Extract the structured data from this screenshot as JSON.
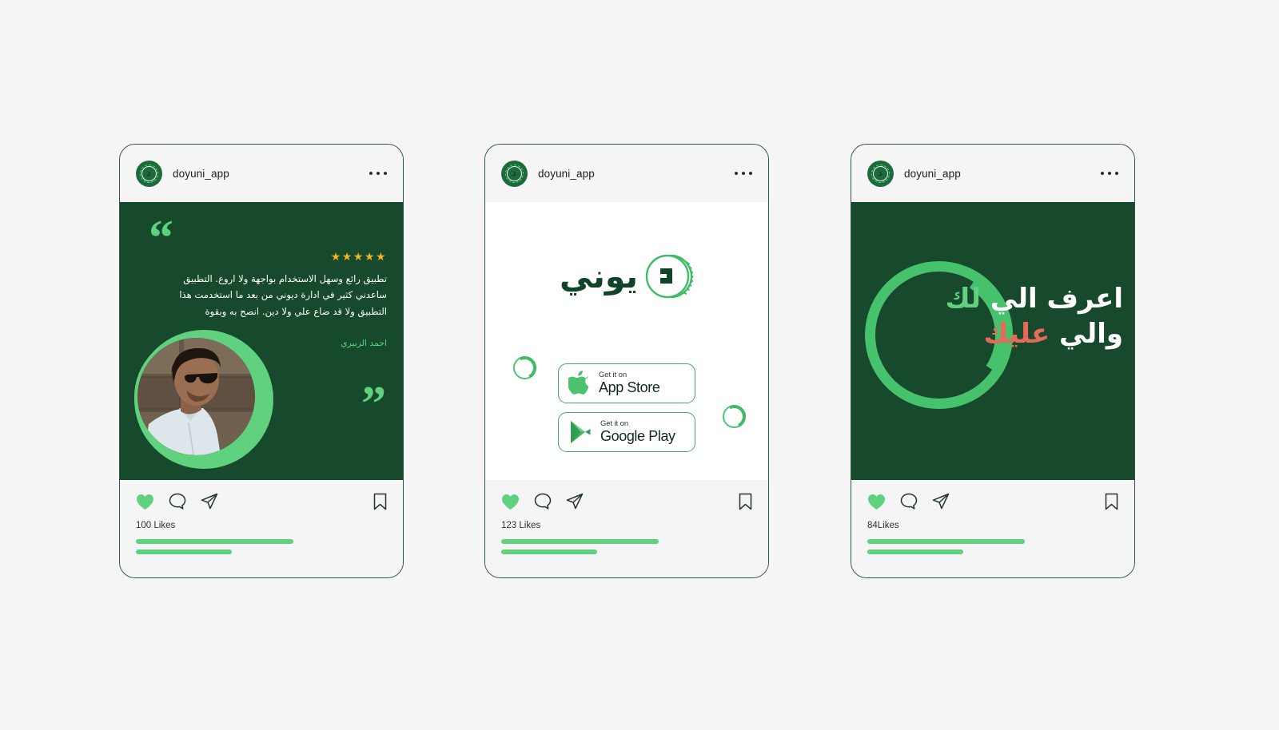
{
  "page": {
    "background_color": "#f4f5f4",
    "accent_green": "#5fd17f",
    "dark_green": "#17492c",
    "brand_green": "#0f4429",
    "accent_red": "#e8685a",
    "star_gold": "#f0b429"
  },
  "posts": [
    {
      "header": {
        "username": "doyuni_app",
        "avatar_letter": "د",
        "menu_label": "···"
      },
      "media": {
        "type": "testimonial",
        "quote_open": "“",
        "quote_close": "”",
        "stars": "★★★★★",
        "star_count": 5,
        "review_text": "تطبيق رائع وسهل الاستخدام بواجهة ولا اروع. التطبيق ساعدني كثير في ادارة ديوني من بعد ما استخدمت هذا التطبيق ولا قد ضاع علي ولا دين. انصح به وبقوة",
        "author": "احمد الزبيري"
      },
      "footer": {
        "likes": "100 Likes"
      }
    },
    {
      "header": {
        "username": "doyuni_app",
        "avatar_letter": "د",
        "menu_label": "···"
      },
      "media": {
        "type": "app-download",
        "logo_word": "يوني",
        "logo_coin_letter": "د",
        "buttons": [
          {
            "small": "Get it on",
            "big": "App Store",
            "icon": "apple-icon"
          },
          {
            "small": "Get it on",
            "big": "Google Play",
            "icon": "google-play-icon"
          }
        ]
      },
      "footer": {
        "likes": "123 Likes"
      }
    },
    {
      "header": {
        "username": "doyuni_app",
        "avatar_letter": "د",
        "menu_label": "···"
      },
      "media": {
        "type": "slogan",
        "slogan_line1_a": "اعرف الي",
        "slogan_line1_b": "لك",
        "slogan_line2_a": "والي",
        "slogan_line2_b": "عليك"
      },
      "footer": {
        "likes": "84Likes"
      }
    }
  ],
  "footer_icons": {
    "like": "heart-icon",
    "comment": "comment-icon",
    "share": "share-icon",
    "save": "bookmark-icon"
  }
}
